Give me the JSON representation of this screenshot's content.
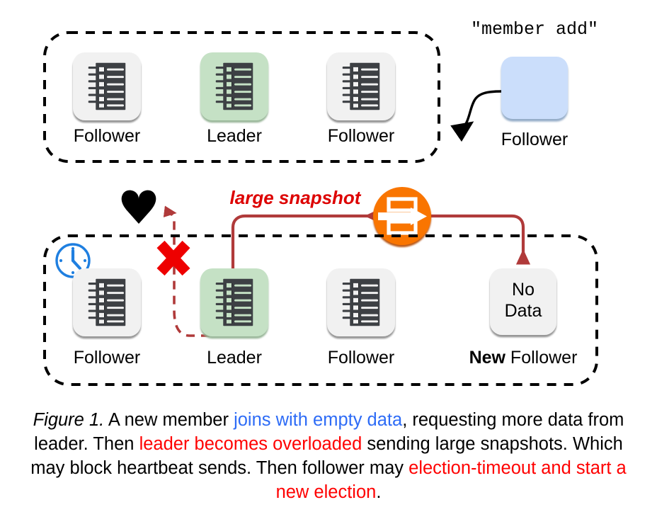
{
  "figure": {
    "caption_prefix": "Figure 1.",
    "caption_part_1": " A new member ",
    "caption_blue_1": "joins with empty data",
    "caption_part_2": ", requesting more data from leader. Then ",
    "caption_red_1": "leader becomes overloaded",
    "caption_part_3": " sending large snapshots. Which may block heartbeat sends. Then follower may ",
    "caption_red_2": "election-timeout and start a new election",
    "caption_part_4": "."
  },
  "top_cluster": {
    "name": "initial-raft-cluster",
    "nodes": [
      {
        "label": "Follower",
        "state": "follower",
        "color": "#f1f1f1"
      },
      {
        "label": "Leader",
        "state": "leader",
        "color": "#c5e1c5"
      },
      {
        "label": "Follower",
        "state": "follower",
        "color": "#f1f1f1"
      }
    ]
  },
  "joining_member": {
    "command": "\"member add\"",
    "label": "Follower",
    "color": "#cbdefb"
  },
  "bottom_cluster": {
    "name": "overloaded-raft-cluster",
    "nodes": [
      {
        "label": "Follower",
        "label_bold": "",
        "state": "follower",
        "color": "#f1f1f1",
        "box_text": ""
      },
      {
        "label": "Leader",
        "label_bold": "",
        "state": "leader",
        "color": "#c5e1c5",
        "box_text": ""
      },
      {
        "label": "Follower",
        "label_bold": "",
        "state": "follower",
        "color": "#f1f1f1",
        "box_text": ""
      },
      {
        "label": " Follower",
        "label_bold": "New",
        "state": "new-follower",
        "color": "#f1f1f1",
        "box_text_line1": "No",
        "box_text_line2": "Data"
      }
    ]
  },
  "annotations": {
    "snapshot_label": "large snapshot",
    "heartbeat_icon": "heart-icon",
    "blocked_icon": "red-x-icon",
    "timeout_icon": "clock-icon",
    "snapshot_transfer_icon": "data-transfer-icon"
  },
  "colors": {
    "leader_green": "#c5e1c5",
    "follower_gray": "#f1f1f1",
    "new_member_blue": "#cbdefb",
    "snapshot_red": "#dd0000",
    "flow_dark_red": "#b03a3a",
    "orange": "#f97405",
    "orange_dark": "#e05a00",
    "clock_blue": "#1f7fe0",
    "x_red": "#ee0000",
    "icon_dark": "#3d4044"
  }
}
